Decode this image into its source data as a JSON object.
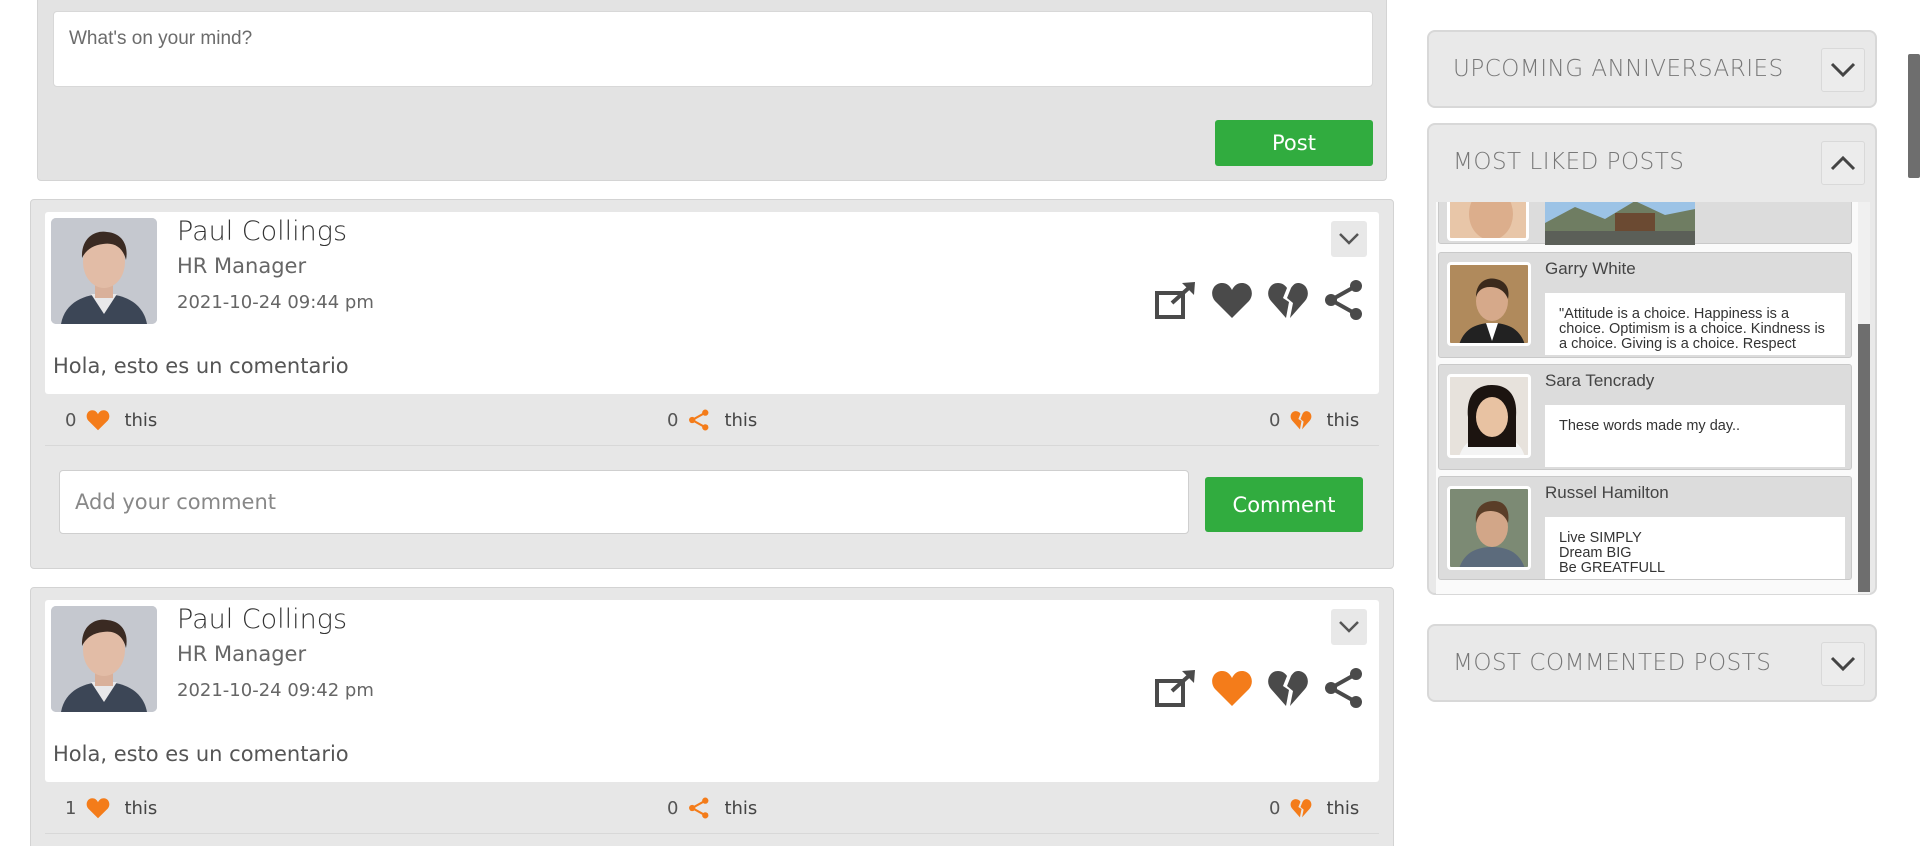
{
  "composer": {
    "placeholder": "What's on your mind?",
    "post_label": "Post"
  },
  "posts": [
    {
      "author": "Paul Collings",
      "role": "HR Manager",
      "date": "2021-10-24  09:44 pm",
      "text": "Hola, esto es un comentario",
      "liked_by_me": false,
      "likes": "0",
      "shares": "0",
      "dislikes": "0",
      "this_label": "this",
      "comment_placeholder": "Add your comment",
      "comment_label": "Comment"
    },
    {
      "author": "Paul Collings",
      "role": "HR Manager",
      "date": "2021-10-24  09:42 pm",
      "text": "Hola, esto es un comentario",
      "liked_by_me": true,
      "likes": "1",
      "shares": "0",
      "dislikes": "0",
      "this_label": "this"
    }
  ],
  "sidebar": {
    "anniversaries_title": "UPCOMING ANNIVERSARIES",
    "liked_title": "MOST LIKED POSTS",
    "commented_title": "MOST COMMENTED POSTS",
    "liked_items": [
      {
        "name": "Garry White",
        "text": "\"Attitude is a choice. Happiness is a choice. Optimism is a choice. Kindness is a choice. Giving is a choice. Respect"
      },
      {
        "name": "Sara Tencrady",
        "text": "These words made my day.."
      },
      {
        "name": "Russel Hamilton",
        "text": "Live SIMPLY\nDream BIG\nBe GREATFULL"
      }
    ]
  },
  "colors": {
    "accent_green": "#31ac3f",
    "accent_orange": "#f47c1a",
    "icon_gray": "#4a4a4a"
  }
}
